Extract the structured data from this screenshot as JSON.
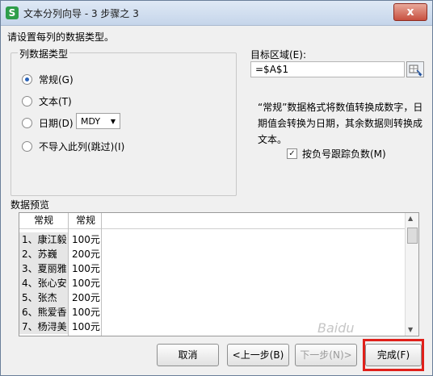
{
  "window": {
    "title": "文本分列向导 - 3 步骤之 3",
    "icon_letter": "S",
    "close_label": "x"
  },
  "instruction": "请设置每列的数据类型。",
  "column_type": {
    "group_label": "列数据类型",
    "options": [
      {
        "label": "常规(G)",
        "selected": true
      },
      {
        "label": "文本(T)",
        "selected": false
      },
      {
        "label": "日期(D)",
        "selected": false
      },
      {
        "label": "不导入此列(跳过)(I)",
        "selected": false
      }
    ],
    "date_format": "MDY"
  },
  "destination": {
    "label": "目标区域(E):",
    "value": "=$A$1"
  },
  "description": "“常规”数据格式将数值转换成数字，日期值会转换为日期，其余数据则转换成文本。",
  "negative_checkbox": {
    "label": "按负号跟踪负数(M)",
    "checked": true
  },
  "preview": {
    "group_label": "数据预览",
    "headers": [
      "常规",
      "常规"
    ],
    "rows": [
      [
        "1、康江毅",
        "100元"
      ],
      [
        "2、苏巍",
        "200元"
      ],
      [
        "3、夏丽雅",
        "100元"
      ],
      [
        "4、张心安",
        "100元"
      ],
      [
        "5、张杰",
        "200元"
      ],
      [
        "6、熊爱香",
        "100元"
      ],
      [
        "7、杨浔美",
        "100元"
      ]
    ]
  },
  "buttons": {
    "cancel": "取消",
    "back": "<上一步(B)",
    "next": "下一步(N)>",
    "finish": "完成(F)"
  },
  "watermark": "Baidu"
}
